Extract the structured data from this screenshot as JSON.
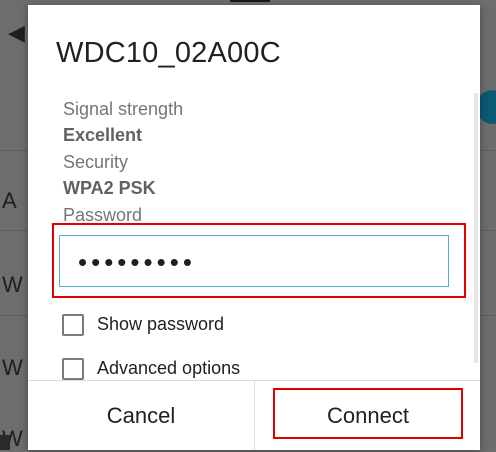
{
  "dialog": {
    "title": "WDC10_02A00C",
    "signal_strength_label": "Signal strength",
    "signal_strength_value": "Excellent",
    "security_label": "Security",
    "security_value": "WPA2 PSK",
    "password_label": "Password",
    "password_masked": "•••••••••",
    "show_password_label": "Show password",
    "advanced_options_label": "Advanced options",
    "cancel_label": "Cancel",
    "connect_label": "Connect"
  },
  "background": {
    "row_letters": [
      "A",
      "W",
      "W",
      "W"
    ]
  },
  "colors": {
    "highlight": "#e00000",
    "input_border": "#57b0bf",
    "scrim": "#6d6d6d"
  }
}
